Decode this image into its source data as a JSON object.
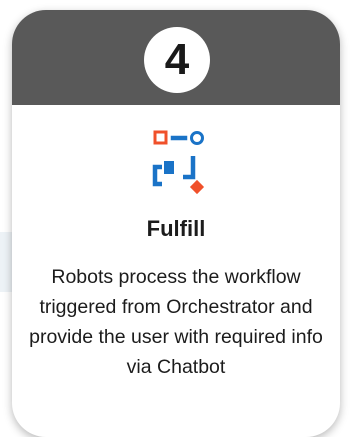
{
  "step": {
    "number": "4"
  },
  "card": {
    "title": "Fulfill",
    "description": "Robots process the workflow triggered from Orchestrator and provide the user with required info via Chatbot"
  },
  "icon": {
    "name": "workflow-icon",
    "colors": {
      "primary": "#1a73c7",
      "accent": "#f0502a"
    }
  },
  "colors": {
    "header": "#595959",
    "card_background": "#ffffff"
  }
}
